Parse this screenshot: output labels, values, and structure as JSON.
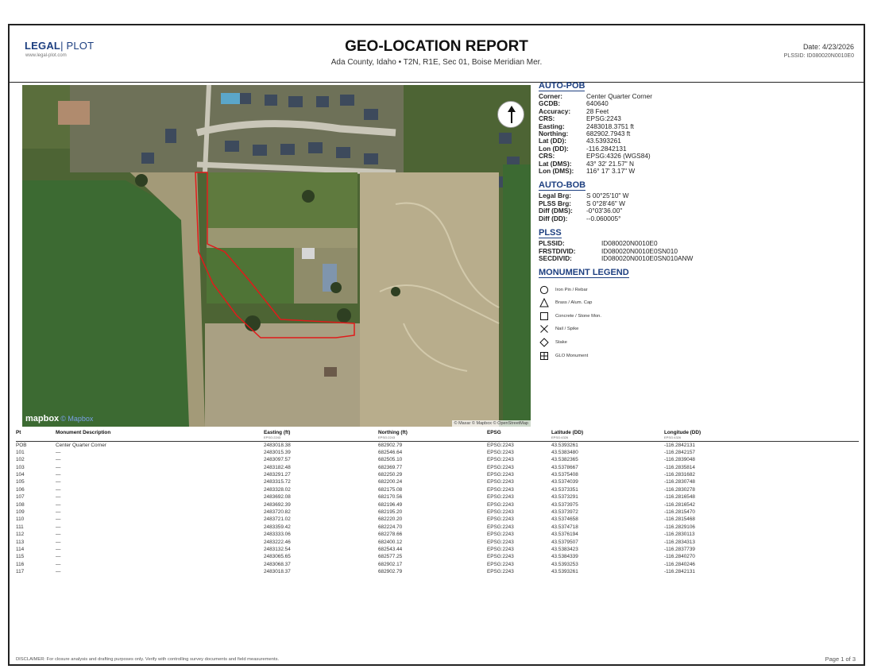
{
  "header": {
    "brand_legal": "LEGAL",
    "brand_sep": "|",
    "brand_plot": "PLOT",
    "brand_url": "www.legal-plot.com",
    "title": "GEO-LOCATION REPORT",
    "subtitle": "Ada County, Idaho • T2N, R1E, Sec 01, Boise Meridian Mer.",
    "date": "Date: 4/23/2026",
    "plssid": "PLSSID: ID080020N0010E0"
  },
  "map": {
    "logo": "mapbox",
    "logo_info": "© Mapbox",
    "attribution": "© Maxar © Mapbox © OpenStreetMap",
    "north_icon": "north-arrow-icon",
    "boundary_color": "#e01b1b"
  },
  "auto_pob": {
    "heading": "AUTO-POB",
    "rows": [
      {
        "k": "Corner:",
        "v": "Center Quarter Corner"
      },
      {
        "k": "GCDB:",
        "v": "640640"
      },
      {
        "k": "Accuracy:",
        "v": "28 Feet"
      },
      {
        "k": "CRS:",
        "v": "EPSG:2243"
      },
      {
        "k": "Easting:",
        "v": "2483018.3751 ft"
      },
      {
        "k": "Northing:",
        "v": "682902.7943 ft"
      },
      {
        "k": "Lat (DD):",
        "v": "43.5393261"
      },
      {
        "k": "Lon (DD):",
        "v": "-116.2842131"
      },
      {
        "k": "CRS:",
        "v": "EPSG:4326 (WGS84)"
      },
      {
        "k": "Lat (DMS):",
        "v": "43° 32' 21.57\" N"
      },
      {
        "k": "Lon (DMS):",
        "v": "116° 17' 3.17\" W"
      }
    ]
  },
  "auto_bob": {
    "heading": "AUTO-BOB",
    "rows": [
      {
        "k": "Legal Brg:",
        "v": "S 00°25'10\" W"
      },
      {
        "k": "PLSS Brg:",
        "v": "S 0°28'46\" W"
      },
      {
        "k": "Diff (DMS):",
        "v": "-0°03'36.00\""
      },
      {
        "k": "Diff (DD):",
        "v": "--0.060005°"
      }
    ]
  },
  "plss": {
    "heading": "PLSS",
    "rows": [
      {
        "k": "PLSSID:",
        "v": "ID080020N0010E0"
      },
      {
        "k": "FRSTDIVID:",
        "v": "ID080020N0010E0SN010"
      },
      {
        "k": "SECDIVID:",
        "v": "ID080020N0010E0SN010ANW"
      }
    ]
  },
  "legend": {
    "heading": "MONUMENT LEGEND",
    "items": [
      {
        "icon": "circle-icon",
        "label": "Iron Pin / Rebar"
      },
      {
        "icon": "triangle-icon",
        "label": "Brass / Alum. Cap"
      },
      {
        "icon": "square-icon",
        "label": "Concrete / Stone Mon."
      },
      {
        "icon": "x-icon",
        "label": "Nail / Spike"
      },
      {
        "icon": "diamond-icon",
        "label": "Stake"
      },
      {
        "icon": "glo-monument-icon",
        "label": "GLO Monument"
      }
    ]
  },
  "table": {
    "columns": [
      {
        "label": "Pt",
        "sub": ""
      },
      {
        "label": "Monument Description",
        "sub": ""
      },
      {
        "label": "Easting (ft)",
        "sub": "EPSG:2243"
      },
      {
        "label": "Northing (ft)",
        "sub": "EPSG:2243"
      },
      {
        "label": "EPSG",
        "sub": ""
      },
      {
        "label": "Latitude (DD)",
        "sub": "EPSG:4326"
      },
      {
        "label": "Longitude (DD)",
        "sub": "EPSG:4326"
      }
    ],
    "rows": [
      [
        "POB",
        "Center Quarter Corner",
        "2483018.38",
        "682902.79",
        "EPSG:2243",
        "43.5393261",
        "-116.2842131"
      ],
      [
        "101",
        "—",
        "2483015.39",
        "682546.64",
        "EPSG:2243",
        "43.5383480",
        "-116.2842157"
      ],
      [
        "102",
        "—",
        "2483097.57",
        "682505.10",
        "EPSG:2243",
        "43.5382365",
        "-116.2839048"
      ],
      [
        "103",
        "—",
        "2483182.48",
        "682369.77",
        "EPSG:2243",
        "43.5378667",
        "-116.2835814"
      ],
      [
        "104",
        "—",
        "2483291.27",
        "682250.29",
        "EPSG:2243",
        "43.5375408",
        "-116.2831682"
      ],
      [
        "105",
        "—",
        "2483315.72",
        "682200.24",
        "EPSG:2243",
        "43.5374039",
        "-116.2830748"
      ],
      [
        "106",
        "—",
        "2483328.02",
        "682175.08",
        "EPSG:2243",
        "43.5373351",
        "-116.2830278"
      ],
      [
        "107",
        "—",
        "2483692.08",
        "682170.56",
        "EPSG:2243",
        "43.5373291",
        "-116.2816548"
      ],
      [
        "108",
        "—",
        "2483692.39",
        "682196.49",
        "EPSG:2243",
        "43.5373975",
        "-116.2816542"
      ],
      [
        "109",
        "—",
        "2483720.82",
        "682195.20",
        "EPSG:2243",
        "43.5373972",
        "-116.2815470"
      ],
      [
        "110",
        "—",
        "2483721.02",
        "682220.20",
        "EPSG:2243",
        "43.5374658",
        "-116.2815468"
      ],
      [
        "111",
        "—",
        "2483359.42",
        "682224.70",
        "EPSG:2243",
        "43.5374718",
        "-116.2829106"
      ],
      [
        "112",
        "—",
        "2483333.06",
        "682278.66",
        "EPSG:2243",
        "43.5376194",
        "-116.2830113"
      ],
      [
        "113",
        "—",
        "2483222.46",
        "682400.12",
        "EPSG:2243",
        "43.5379507",
        "-116.2834313"
      ],
      [
        "114",
        "—",
        "2483132.54",
        "682543.44",
        "EPSG:2243",
        "43.5383423",
        "-116.2837739"
      ],
      [
        "115",
        "—",
        "2483065.65",
        "682577.25",
        "EPSG:2243",
        "43.5384339",
        "-116.2840270"
      ],
      [
        "116",
        "—",
        "2483068.37",
        "682902.17",
        "EPSG:2243",
        "43.5393253",
        "-116.2840246"
      ],
      [
        "117",
        "—",
        "2483018.37",
        "682902.79",
        "EPSG:2243",
        "43.5393261",
        "-116.2842131"
      ]
    ]
  },
  "footer": {
    "disclaimer": "DISCLAIMER: For closure analysis and drafting purposes only. Verify with controlling survey documents and field measurements.",
    "page": "Page 1 of 3"
  }
}
